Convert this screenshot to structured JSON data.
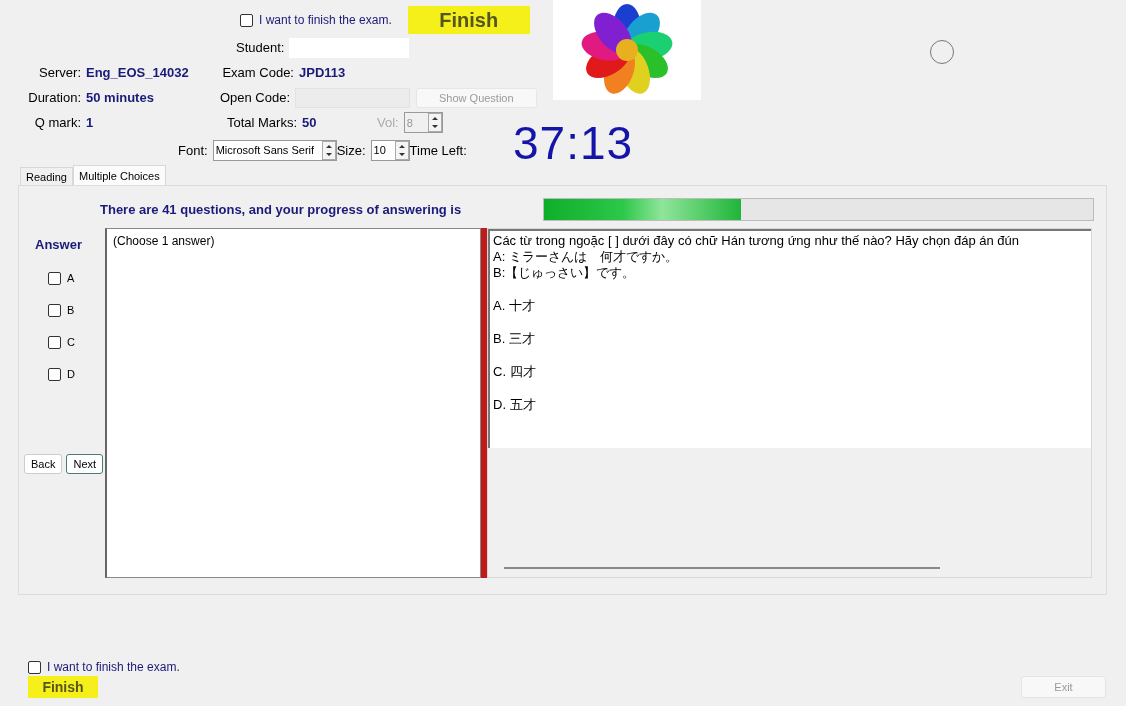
{
  "top_finish": {
    "label": "I want to finish the exam.",
    "checked": false
  },
  "finish_button": "Finish",
  "student": {
    "label": "Student:"
  },
  "info": {
    "server": {
      "label": "Server:",
      "value": "Eng_EOS_14032"
    },
    "exam_code": {
      "label": "Exam Code:",
      "value": "JPD113"
    },
    "duration": {
      "label": "Duration:",
      "value": "50 minutes"
    },
    "open_code": {
      "label": "Open Code:"
    },
    "show_question": {
      "label": "Show Question",
      "disabled": true
    },
    "q_mark": {
      "label": "Q mark:",
      "value": "1"
    },
    "total_marks": {
      "label": "Total Marks:",
      "value": "50"
    },
    "vol": {
      "label": "Vol:",
      "value": "8",
      "disabled": true
    },
    "font": {
      "label": "Font:",
      "value": "Microsoft Sans Serif"
    },
    "size": {
      "label": "Size:",
      "value": "10"
    },
    "time_left": {
      "label": "Time Left:",
      "value": "37:13"
    }
  },
  "tabs": [
    {
      "label": "Reading",
      "selected": false
    },
    {
      "label": "Multiple Choices",
      "selected": true
    }
  ],
  "progress": {
    "text": "There are 41 questions, and your progress of answering is",
    "level": 0.36
  },
  "answer": {
    "title": "Answer",
    "options": [
      {
        "label": "A",
        "checked": false
      },
      {
        "label": "B",
        "checked": false
      },
      {
        "label": "C",
        "checked": false
      },
      {
        "label": "D",
        "checked": false
      }
    ]
  },
  "nav": [
    "Back",
    "Next"
  ],
  "answer_hint": "(Choose 1 answer)",
  "question": {
    "lines": [
      "Các từ trong ngoặc [    ]  dưới đây có chữ Hán tương ứng như thế nào? Hãy chọn đáp án đún",
      "A:  ミラーさんは　何才ですか。",
      "B:【じゅっさい】です。"
    ],
    "choices": [
      "A.  十才",
      "B.  三才",
      "C.  四才",
      "D.  五才"
    ]
  },
  "bottom_finish": {
    "label": "I want to finish the exam.",
    "checked": false
  },
  "bottom_finish_button": "Finish",
  "exit": {
    "label": "Exit",
    "disabled": true
  }
}
